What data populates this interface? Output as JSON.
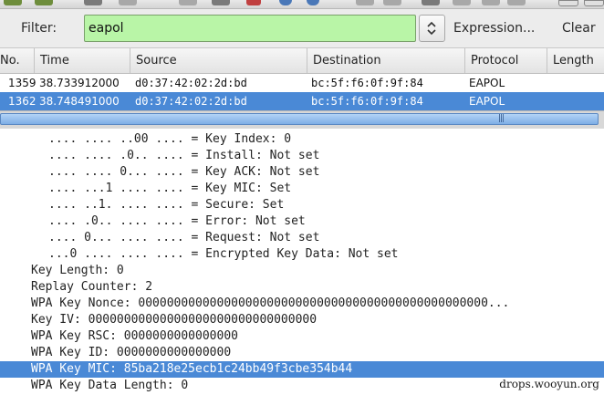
{
  "filter": {
    "label": "Filter:",
    "value": "eapol",
    "expression_label": "Expression...",
    "clear_label": "Clear"
  },
  "packet_list": {
    "columns": [
      "No.",
      "Time",
      "Source",
      "Destination",
      "Protocol",
      "Length"
    ],
    "rows": [
      {
        "no": "1359",
        "time": "38.733912000",
        "source": "d0:37:42:02:2d:bd",
        "destination": "bc:5f:f6:0f:9f:84",
        "protocol": "EAPOL",
        "selected": false
      },
      {
        "no": "1362",
        "time": "38.748491000",
        "source": "d0:37:42:02:2d:bd",
        "destination": "bc:5f:f6:0f:9f:84",
        "protocol": "EAPOL",
        "selected": true
      }
    ]
  },
  "details": {
    "lines": [
      ".... .... ..00 .... = Key Index: 0",
      ".... .... .0.. .... = Install: Not set",
      ".... .... 0... .... = Key ACK: Not set",
      ".... ...1 .... .... = Key MIC: Set",
      ".... ..1. .... .... = Secure: Set",
      ".... .0.. .... .... = Error: Not set",
      ".... 0... .... .... = Request: Not set",
      "...0 .... .... .... = Encrypted Key Data: Not set",
      "Key Length: 0",
      "Replay Counter: 2",
      "WPA Key Nonce: 0000000000000000000000000000000000000000000000000...",
      "Key IV: 00000000000000000000000000000000",
      "WPA Key RSC: 0000000000000000",
      "WPA Key ID: 0000000000000000",
      "WPA Key MIC: 85ba218e25ecb1c24bb49f3cbe354b44",
      "WPA Key Data Length: 0"
    ],
    "selected_index": 14
  },
  "watermark": "drops.wooyun.org"
}
